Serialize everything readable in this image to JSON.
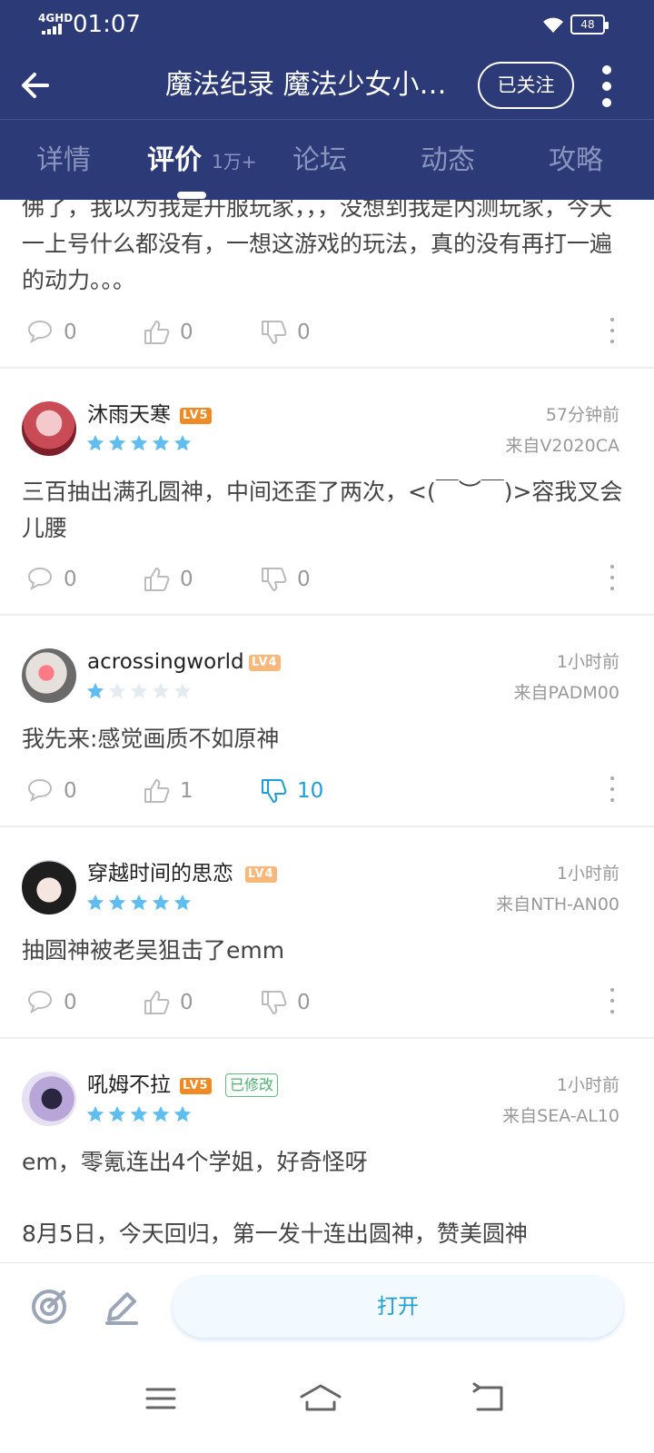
{
  "status_bar": {
    "network": "4GHD",
    "time": "01:07",
    "battery": "48"
  },
  "header": {
    "title": "魔法纪录  魔法少女小…",
    "follow_label": "已关注",
    "tabs": [
      {
        "label": "详情",
        "active": false
      },
      {
        "label": "评价",
        "active": true,
        "count": "1万+"
      },
      {
        "label": "论坛",
        "active": false
      },
      {
        "label": "动态",
        "active": false
      },
      {
        "label": "攻略",
        "active": false
      }
    ]
  },
  "colors": {
    "header_bg": "#2c3a78",
    "accent": "#1b9fd6",
    "star": "#5fbdf0",
    "star_empty": "#e4ebf1",
    "lv5": "#f08a24",
    "lv4": "#f7b87a"
  },
  "reviews": [
    {
      "partial": true,
      "text": "佛了，我以为我是开服玩家，，，没想到我是内测玩家，今天一上号什么都没有，一想这游戏的玩法，真的没有再打一遍的动力。。。",
      "comments": "0",
      "likes": "0",
      "dislikes": "0"
    },
    {
      "username": "沐雨天寒",
      "level": "LV5",
      "stars": 5,
      "time": "57分钟前",
      "device": "来自V2020CA",
      "text": "三百抽出满孔圆神，中间还歪了两次，<(￣︶￣)>容我叉会儿腰",
      "comments": "0",
      "likes": "0",
      "dislikes": "0"
    },
    {
      "username": "acrossingworld",
      "level": "LV4",
      "stars": 1,
      "time": "1小时前",
      "device": "来自PADM00",
      "text": "我先来:感觉画质不如原神",
      "comments": "0",
      "likes": "1",
      "dislikes": "10"
    },
    {
      "username": "穿越时间的思恋",
      "level": "LV4",
      "stars": 5,
      "time": "1小时前",
      "device": "来自NTH-AN00",
      "text": "抽圆神被老吴狙击了emm",
      "comments": "0",
      "likes": "0",
      "dislikes": "0"
    },
    {
      "username": "吼姆不拉",
      "level": "LV5",
      "edited": "已修改",
      "stars": 5,
      "time": "1小时前",
      "device": "来自SEA-AL10",
      "text_line1": "em，零氪连出4个学姐，好奇怪呀",
      "text_line2": "8月5日，今天回归，第一发十连出圆神，赞美圆神"
    }
  ],
  "bottom_bar": {
    "open_label": "打开"
  },
  "icons": [
    "back-arrow-icon",
    "more-vertical-icon",
    "comment-icon",
    "thumbs-up-icon",
    "thumbs-down-icon",
    "kebab-icon",
    "star-icon",
    "target-icon",
    "edit-pencil-icon",
    "menu-icon",
    "home-icon",
    "back-icon"
  ]
}
